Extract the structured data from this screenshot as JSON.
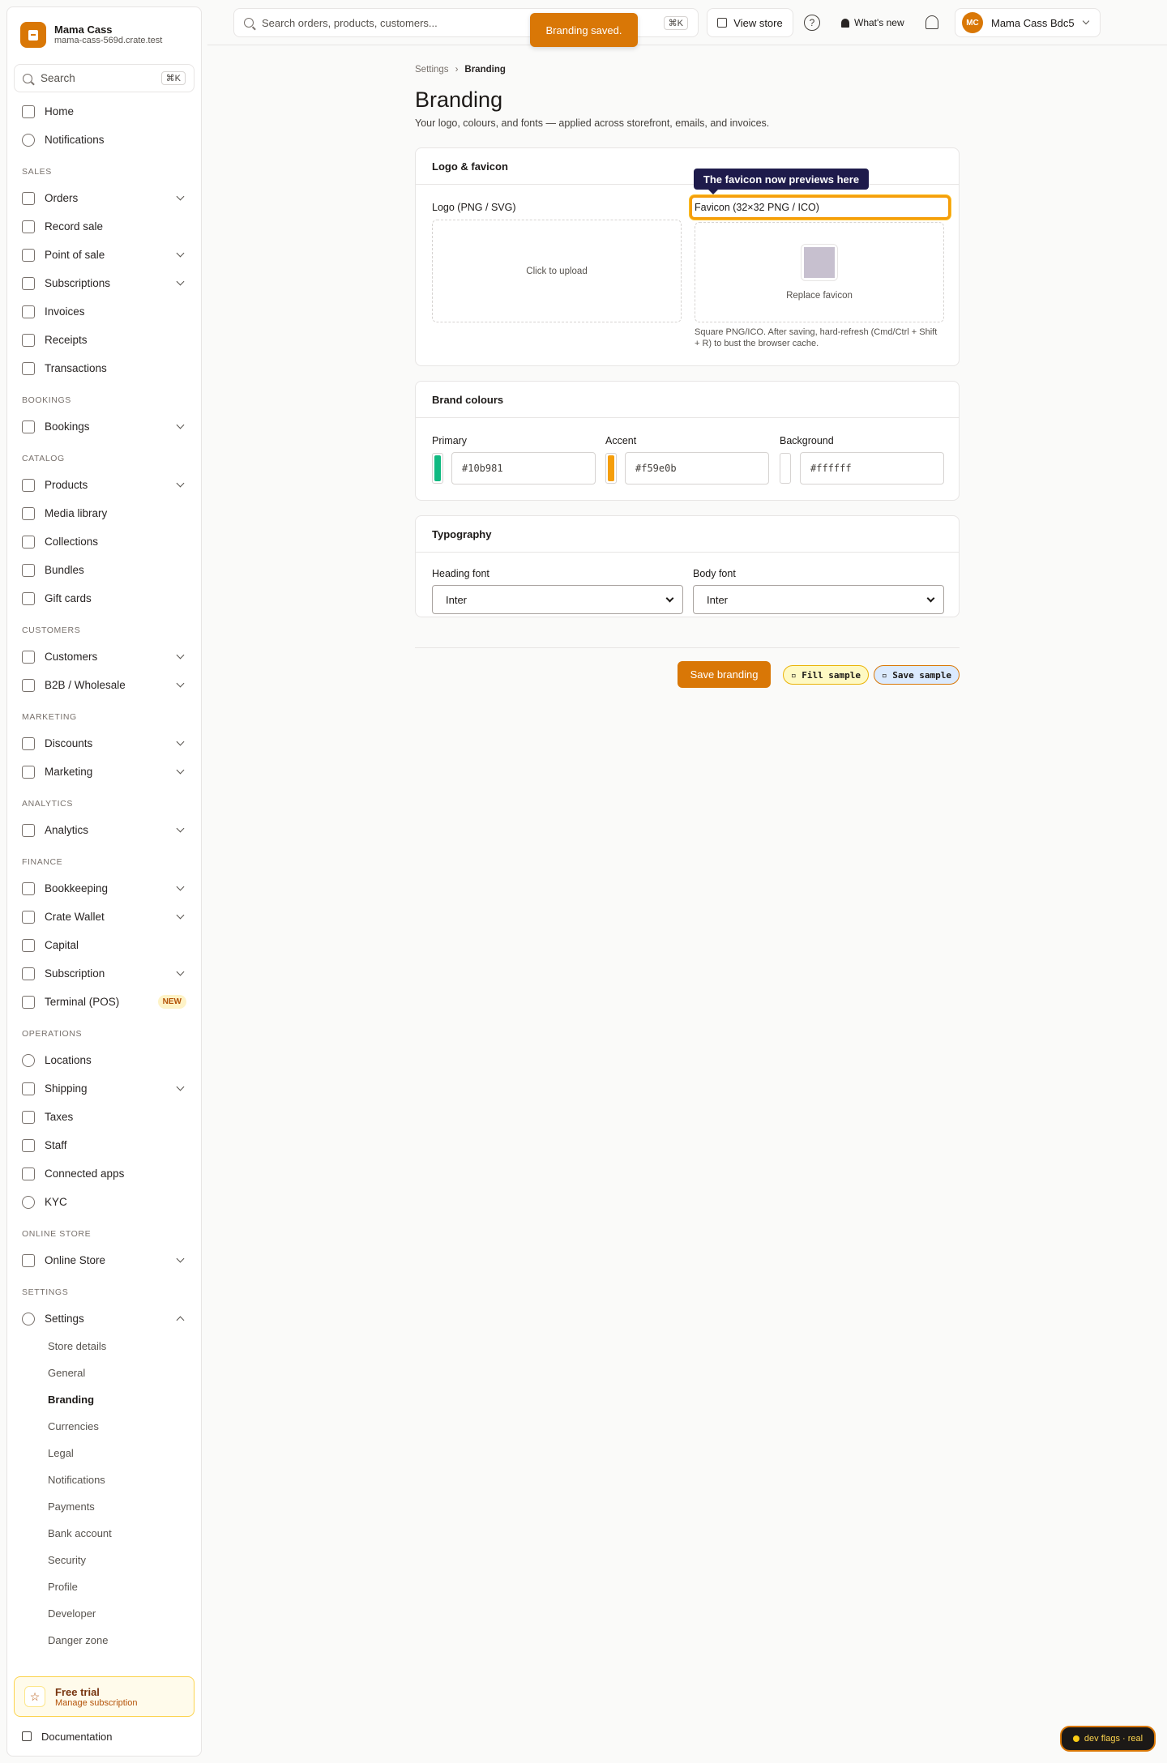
{
  "brand": {
    "name": "Mama Cass",
    "domain": "mama-cass-569d.crate.test"
  },
  "sidebar": {
    "search_label": "Search",
    "search_kbd": "⌘K",
    "top_items": [
      {
        "label": "Home",
        "icon": "home-icon"
      },
      {
        "label": "Notifications",
        "icon": "chat-bubble-icon"
      }
    ],
    "sections": [
      {
        "title": "SALES",
        "items": [
          {
            "label": "Orders",
            "icon": "box-icon",
            "chevron": true
          },
          {
            "label": "Record sale",
            "icon": "receipt-icon",
            "chevron": false
          },
          {
            "label": "Point of sale",
            "icon": "grid-icon",
            "chevron": true
          },
          {
            "label": "Subscriptions",
            "icon": "repeat-icon",
            "chevron": true
          },
          {
            "label": "Invoices",
            "icon": "document-icon",
            "chevron": false
          },
          {
            "label": "Receipts",
            "icon": "receipt-icon",
            "chevron": false
          },
          {
            "label": "Transactions",
            "icon": "credit-card-icon",
            "chevron": false
          }
        ]
      },
      {
        "title": "BOOKINGS",
        "items": [
          {
            "label": "Bookings",
            "icon": "calendar-icon",
            "chevron": true
          }
        ]
      },
      {
        "title": "CATALOG",
        "items": [
          {
            "label": "Products",
            "icon": "cube-icon",
            "chevron": true
          },
          {
            "label": "Media library",
            "icon": "image-icon",
            "chevron": false
          },
          {
            "label": "Collections",
            "icon": "grid-icon",
            "chevron": false
          },
          {
            "label": "Bundles",
            "icon": "layers-icon",
            "chevron": false
          },
          {
            "label": "Gift cards",
            "icon": "gift-icon",
            "chevron": false
          }
        ]
      },
      {
        "title": "CUSTOMERS",
        "items": [
          {
            "label": "Customers",
            "icon": "users-icon",
            "chevron": true
          },
          {
            "label": "B2B / Wholesale",
            "icon": "users-icon",
            "chevron": true
          }
        ]
      },
      {
        "title": "MARKETING",
        "items": [
          {
            "label": "Discounts",
            "icon": "percent-icon",
            "chevron": true
          },
          {
            "label": "Marketing",
            "icon": "megaphone-icon",
            "chevron": true
          }
        ]
      },
      {
        "title": "ANALYTICS",
        "items": [
          {
            "label": "Analytics",
            "icon": "chart-icon",
            "chevron": true
          }
        ]
      },
      {
        "title": "FINANCE",
        "items": [
          {
            "label": "Bookkeeping",
            "icon": "ledger-icon",
            "chevron": true
          },
          {
            "label": "Crate Wallet",
            "icon": "wallet-icon",
            "chevron": true
          },
          {
            "label": "Capital",
            "icon": "dollar-icon",
            "chevron": false
          },
          {
            "label": "Subscription",
            "icon": "credit-card-icon",
            "chevron": true
          },
          {
            "label": "Terminal (POS)",
            "icon": "terminal-icon",
            "chevron": false,
            "badge": "NEW"
          }
        ]
      },
      {
        "title": "OPERATIONS",
        "items": [
          {
            "label": "Locations",
            "icon": "pin-icon",
            "chevron": false
          },
          {
            "label": "Shipping",
            "icon": "truck-icon",
            "chevron": true
          },
          {
            "label": "Taxes",
            "icon": "receipt-icon",
            "chevron": false
          },
          {
            "label": "Staff",
            "icon": "user-plus-icon",
            "chevron": false
          },
          {
            "label": "Connected apps",
            "icon": "code-icon",
            "chevron": false
          },
          {
            "label": "KYC",
            "icon": "shield-icon",
            "chevron": false
          }
        ]
      },
      {
        "title": "ONLINE STORE",
        "items": [
          {
            "label": "Online Store",
            "icon": "store-icon",
            "chevron": true
          }
        ]
      },
      {
        "title": "SETTINGS",
        "items": [
          {
            "label": "Settings",
            "icon": "gear-icon",
            "chevron": true,
            "expanded": true
          }
        ]
      }
    ],
    "settings_sub": [
      "Store details",
      "General",
      "Branding",
      "Currencies",
      "Legal",
      "Notifications",
      "Payments",
      "Bank account",
      "Security",
      "Profile",
      "Developer",
      "Danger zone"
    ],
    "settings_active": "Branding",
    "trial": {
      "title": "Free trial",
      "sub": "Manage subscription"
    },
    "docs_label": "Documentation"
  },
  "topbar": {
    "search_placeholder": "Search orders, products, customers...",
    "search_kbd": "⌘K",
    "view_store": "View store",
    "help_glyph": "?",
    "whats_new": "What's new",
    "user_initials": "MC",
    "user_name": "Mama Cass Bdc5"
  },
  "toast": "Branding saved.",
  "page": {
    "breadcrumb_parent": "Settings",
    "breadcrumb_current": "Branding",
    "title": "Branding",
    "subtitle": "Your logo, colours, and fonts — applied across storefront, emails, and invoices."
  },
  "logo_card": {
    "title": "Logo & favicon",
    "logo_label": "Logo (PNG / SVG)",
    "logo_drop": "Click to upload",
    "favicon_label": "Favicon (32×32 PNG / ICO)",
    "favicon_action": "Replace favicon",
    "favicon_hint": "Square PNG/ICO. After saving, hard-refresh (Cmd/Ctrl + Shift + R) to bust the browser cache.",
    "tooltip": "The favicon now previews here"
  },
  "colours_card": {
    "title": "Brand colours",
    "fields": [
      {
        "label": "Primary",
        "value": "#10b981"
      },
      {
        "label": "Accent",
        "value": "#f59e0b"
      },
      {
        "label": "Background",
        "value": "#ffffff"
      }
    ]
  },
  "type_card": {
    "title": "Typography",
    "heading_label": "Heading font",
    "heading_value": "Inter",
    "body_label": "Body font",
    "body_value": "Inter"
  },
  "actions": {
    "save": "Save branding",
    "fill_sample": "▫ Fill sample",
    "save_sample": "▫ Save sample"
  },
  "devflags": "dev flags · real",
  "colors": {
    "accent": "#d97706",
    "tooltip_bg": "#1e1b4b"
  }
}
